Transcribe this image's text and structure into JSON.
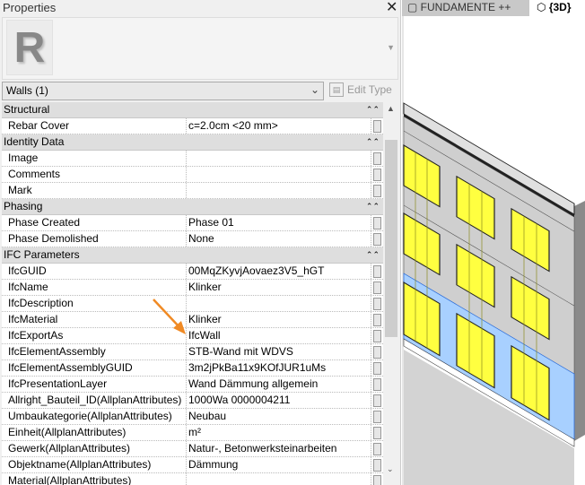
{
  "panel": {
    "title": "Properties",
    "type_selector": "Walls (1)",
    "edit_type": "Edit Type",
    "logo_letter": "R"
  },
  "tabs": [
    {
      "label": "FUNDAMENTE ++"
    },
    {
      "label": "{3D}"
    }
  ],
  "rows": [
    {
      "group": "Structural"
    },
    {
      "label": "Rebar Cover",
      "value": "c=2.0cm <20 mm>"
    },
    {
      "group": "Identity Data"
    },
    {
      "label": "Image",
      "value": ""
    },
    {
      "label": "Comments",
      "value": ""
    },
    {
      "label": "Mark",
      "value": ""
    },
    {
      "group": "Phasing"
    },
    {
      "label": "Phase Created",
      "value": "Phase 01"
    },
    {
      "label": "Phase Demolished",
      "value": "None"
    },
    {
      "group": "IFC Parameters"
    },
    {
      "label": "IfcGUID",
      "value": "00MqZKyvjAovaez3V5_hGT"
    },
    {
      "label": "IfcName",
      "value": "Klinker"
    },
    {
      "label": "IfcDescription",
      "value": ""
    },
    {
      "label": "IfcMaterial",
      "value": "Klinker"
    },
    {
      "label": "IfcExportAs",
      "value": "IfcWall"
    },
    {
      "label": "IfcElementAssembly",
      "value": "STB-Wand mit WDVS"
    },
    {
      "label": "IfcElementAssemblyGUID",
      "value": "3m2jPkBa11x9KOfJUR1uMs"
    },
    {
      "label": "IfcPresentationLayer",
      "value": "Wand Dämmung allgemein"
    },
    {
      "label": "Allright_Bauteil_ID(AllplanAttributes)",
      "value": "1000Wa 0000004211"
    },
    {
      "label": "Umbaukategorie(AllplanAttributes)",
      "value": "Neubau"
    },
    {
      "label": "Einheit(AllplanAttributes)",
      "value": "m²"
    },
    {
      "label": "Gewerk(AllplanAttributes)",
      "value": "Natur-, Betonwerksteinarbeiten"
    },
    {
      "label": "Objektname(AllplanAttributes)",
      "value": "Dämmung"
    },
    {
      "label": "Material(AllplanAttributes)",
      "value": ""
    }
  ],
  "colors": {
    "selection": "#a8d0ff",
    "window": "#ffff40",
    "arrow": "#f08a24"
  }
}
